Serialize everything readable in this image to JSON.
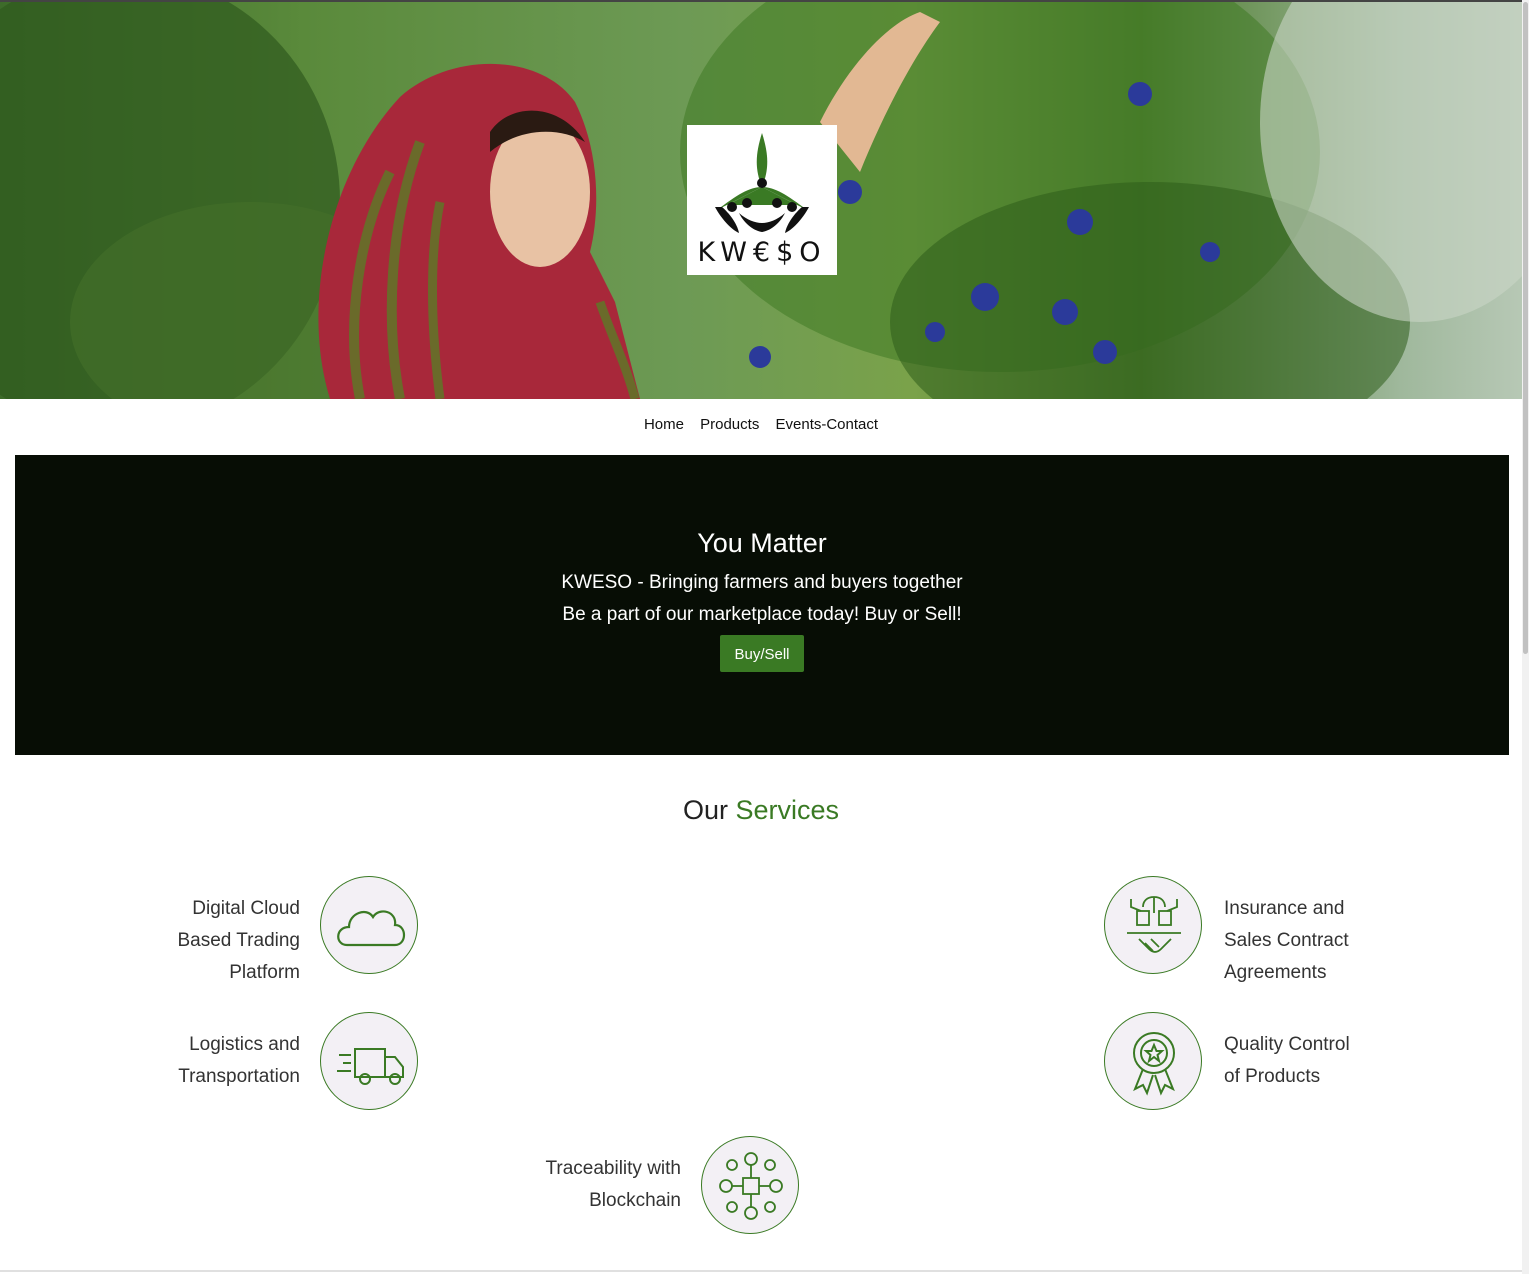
{
  "logo": {
    "text": "KW€$O"
  },
  "nav": {
    "items": [
      "Home",
      "Products",
      "Events-Contact"
    ]
  },
  "banner": {
    "title": "You Matter",
    "line1": "KWESO - Bringing farmers and buyers together",
    "line2": "Be a part of our marketplace today! Buy or Sell!",
    "button": "Buy/Sell"
  },
  "services": {
    "title_prefix": "Our",
    "title_accent": "Services",
    "items": [
      {
        "label_lines": [
          "Digital Cloud",
          "Based Trading",
          "Platform"
        ],
        "icon": "cloud-icon"
      },
      {
        "label_lines": [
          "Insurance and",
          "Sales Contract",
          "Agreements"
        ],
        "icon": "handshake-icon"
      },
      {
        "label_lines": [
          "Logistics and",
          "Transportation"
        ],
        "icon": "truck-icon"
      },
      {
        "label_lines": [
          "Quality Control",
          "of Products"
        ],
        "icon": "award-ribbon-icon"
      },
      {
        "label_lines": [
          "Traceability with",
          "Blockchain"
        ],
        "icon": "blockchain-icon"
      }
    ]
  },
  "colors": {
    "accent": "#3a7a24",
    "banner_bg": "#070d05",
    "circle_bg": "#f3f0f5"
  }
}
